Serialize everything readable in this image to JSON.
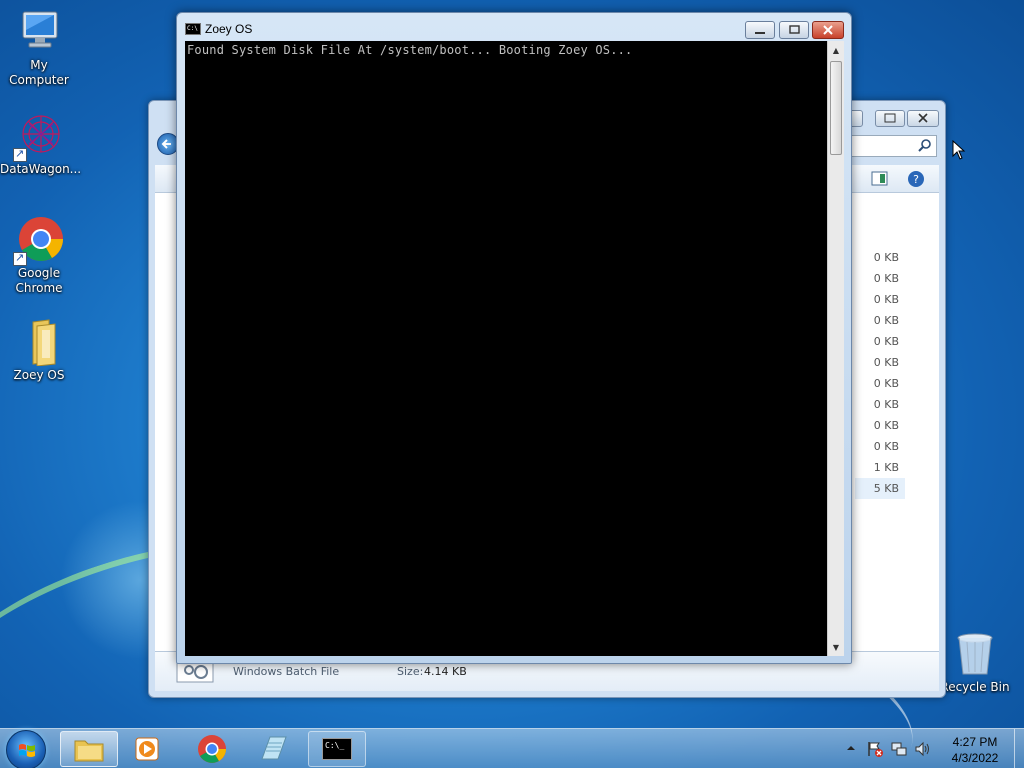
{
  "desktop": {
    "icons": [
      {
        "label": "My Computer"
      },
      {
        "label": "DataWagon..."
      },
      {
        "label": "Google Chrome"
      },
      {
        "label": "Zoey OS"
      },
      {
        "label": "Recycle Bin"
      }
    ]
  },
  "cmd_window": {
    "title": "Zoey OS",
    "icon_text": "C:\\",
    "output": "Found System Disk File At /system/boot... Booting Zoey OS..."
  },
  "explorer": {
    "file_sizes": [
      "0 KB",
      "0 KB",
      "0 KB",
      "0 KB",
      "0 KB",
      "0 KB",
      "0 KB",
      "0 KB",
      "0 KB",
      "0 KB",
      "1 KB",
      "5 KB"
    ],
    "status_type": "Windows Batch File",
    "status_size_label": "Size:",
    "status_size_value": "4.14 KB"
  },
  "taskbar": {
    "clock_time": "4:27 PM",
    "clock_date": "4/3/2022",
    "cmd_glyph": "C:\\_"
  }
}
